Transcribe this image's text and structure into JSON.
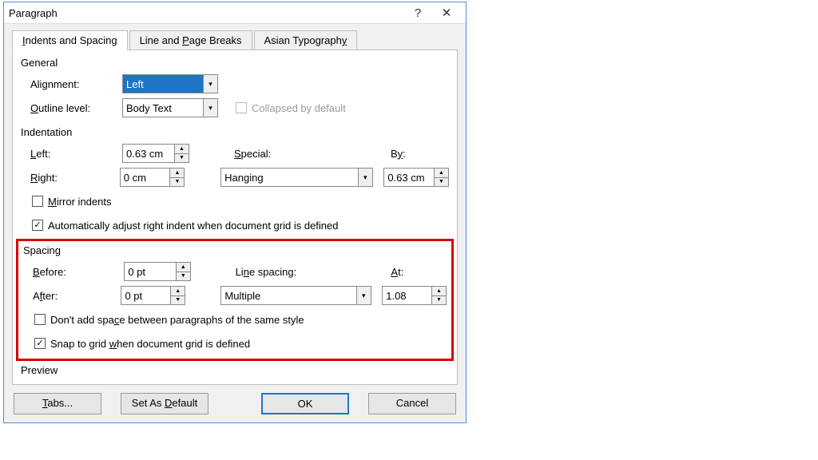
{
  "title": "Paragraph",
  "tabs": {
    "t0": "Indents and Spacing",
    "t1": "Line and Page Breaks",
    "t2": "Asian Typography"
  },
  "general": {
    "heading": "General",
    "alignment_label": "Alignment:",
    "alignment_value": "Left",
    "outline_label": "Outline level:",
    "outline_value": "Body Text",
    "collapsed_label": "Collapsed by default"
  },
  "indentation": {
    "heading": "Indentation",
    "left_label": "Left:",
    "left_value": "0.63 cm",
    "right_label": "Right:",
    "right_value": "0 cm",
    "special_label": "Special:",
    "special_value": "Hanging",
    "by_label": "By:",
    "by_value": "0.63 cm",
    "mirror_label": "Mirror indents",
    "auto_label": "Automatically adjust right indent when document grid is defined"
  },
  "spacing": {
    "heading": "Spacing",
    "before_label": "Before:",
    "before_value": "0 pt",
    "after_label": "After:",
    "after_value": "0 pt",
    "line_label": "Line spacing:",
    "line_value": "Multiple",
    "at_label": "At:",
    "at_value": "1.08",
    "dont_add_label": "Don't add space between paragraphs of the same style",
    "snap_label": "Snap to grid when document grid is defined"
  },
  "preview": "Preview",
  "buttons": {
    "tabs": "Tabs...",
    "set_default": "Set As Default",
    "ok": "OK",
    "cancel": "Cancel"
  }
}
